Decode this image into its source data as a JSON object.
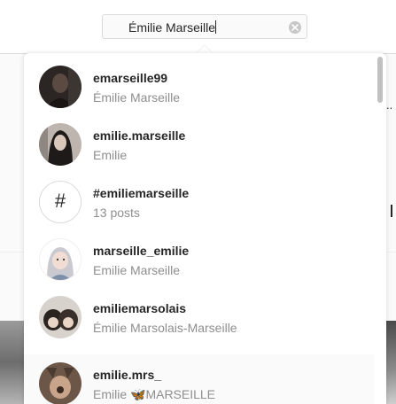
{
  "search": {
    "value": "Émilie Marseille",
    "clear_icon": "clear-circle-icon"
  },
  "results": [
    {
      "username": "emarseille99",
      "subtitle": "Émilie Marseille",
      "kind": "user"
    },
    {
      "username": "emilie.marseille",
      "subtitle": "Emilie",
      "kind": "user"
    },
    {
      "username": "#emiliemarseille",
      "subtitle": "13 posts",
      "kind": "hashtag",
      "glyph": "#"
    },
    {
      "username": "marseille_emilie",
      "subtitle": "Emilie Marseille",
      "kind": "user"
    },
    {
      "username": "emiliemarsolais",
      "subtitle": "Émilie Marsolais-Marseille",
      "kind": "user"
    },
    {
      "username": "emilie.mrs_",
      "subtitle": "Emilie 🦋MARSEILLE",
      "kind": "user"
    }
  ],
  "background": {
    "dots": "..",
    "colors": {
      "border": "#dbdbdb",
      "text": "#262626",
      "muted": "#8e8e8e"
    }
  }
}
